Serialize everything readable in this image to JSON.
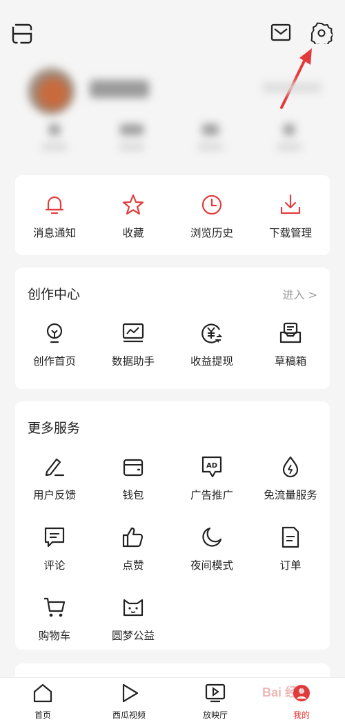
{
  "header": {
    "scan_icon": "scan-icon",
    "mail_icon": "mail-icon",
    "settings_icon": "gear-icon"
  },
  "quick_actions": [
    {
      "label": "消息通知",
      "icon": "bell-icon"
    },
    {
      "label": "收藏",
      "icon": "star-icon"
    },
    {
      "label": "浏览历史",
      "icon": "clock-icon"
    },
    {
      "label": "下载管理",
      "icon": "download-icon"
    }
  ],
  "creation": {
    "title": "创作中心",
    "enter": "进入 >",
    "items": [
      {
        "label": "创作首页",
        "icon": "lightbulb-icon"
      },
      {
        "label": "数据助手",
        "icon": "chart-monitor-icon"
      },
      {
        "label": "收益提现",
        "icon": "yuan-coin-icon"
      },
      {
        "label": "草稿箱",
        "icon": "draft-box-icon"
      }
    ]
  },
  "more": {
    "title": "更多服务",
    "items": [
      {
        "label": "用户反馈",
        "icon": "pen-icon"
      },
      {
        "label": "钱包",
        "icon": "wallet-icon"
      },
      {
        "label": "广告推广",
        "icon": "ad-icon"
      },
      {
        "label": "免流量服务",
        "icon": "drop-icon"
      },
      {
        "label": "评论",
        "icon": "comment-icon"
      },
      {
        "label": "点赞",
        "icon": "thumbs-up-icon"
      },
      {
        "label": "夜间模式",
        "icon": "moon-icon"
      },
      {
        "label": "订单",
        "icon": "order-icon"
      },
      {
        "label": "购物车",
        "icon": "cart-icon"
      },
      {
        "label": "圆梦公益",
        "icon": "cat-face-icon"
      }
    ]
  },
  "nav": [
    {
      "label": "首页",
      "icon": "home-icon"
    },
    {
      "label": "西瓜视频",
      "icon": "play-icon"
    },
    {
      "label": "放映厅",
      "icon": "tv-icon"
    },
    {
      "label": "我的",
      "icon": "profile-icon"
    }
  ],
  "watermark": "Bai 经验",
  "colors": {
    "accent": "#e33d3d",
    "icon": "#222222"
  }
}
